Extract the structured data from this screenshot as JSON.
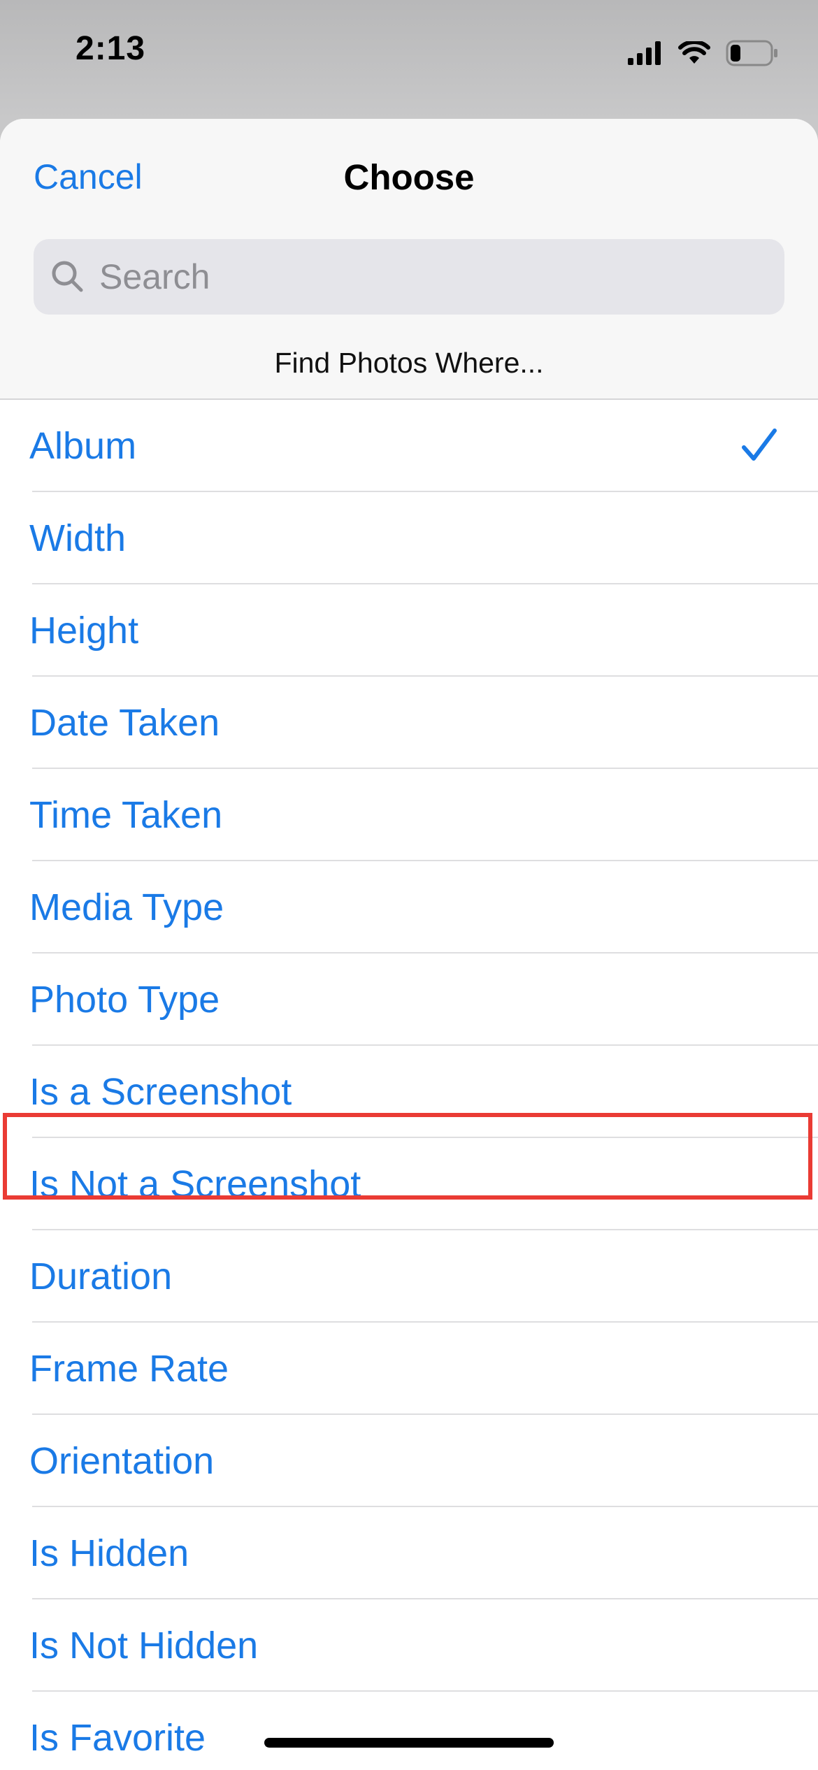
{
  "status_bar": {
    "time": "2:13",
    "icons": [
      "cellular-signal-icon",
      "wifi-icon",
      "battery-icon"
    ],
    "battery_level": 0.25
  },
  "sheet": {
    "cancel_label": "Cancel",
    "title": "Choose",
    "search": {
      "placeholder": "Search",
      "value": ""
    },
    "section_header": "Find Photos Where..."
  },
  "options": [
    {
      "label": "Album",
      "selected": true
    },
    {
      "label": "Width",
      "selected": false
    },
    {
      "label": "Height",
      "selected": false
    },
    {
      "label": "Date Taken",
      "selected": false
    },
    {
      "label": "Time Taken",
      "selected": false
    },
    {
      "label": "Media Type",
      "selected": false
    },
    {
      "label": "Photo Type",
      "selected": false
    },
    {
      "label": "Is a Screenshot",
      "selected": false
    },
    {
      "label": "Is Not a Screenshot",
      "selected": false
    },
    {
      "label": "Duration",
      "selected": false,
      "highlighted": true
    },
    {
      "label": "Frame Rate",
      "selected": false
    },
    {
      "label": "Orientation",
      "selected": false
    },
    {
      "label": "Is Hidden",
      "selected": false
    },
    {
      "label": "Is Not Hidden",
      "selected": false
    },
    {
      "label": "Is Favorite",
      "selected": false
    }
  ],
  "colors": {
    "accent": "#1a7ae6",
    "highlight": "#ea3b34",
    "header_bg": "#f7f7f7",
    "search_bg": "#e5e5ea"
  }
}
